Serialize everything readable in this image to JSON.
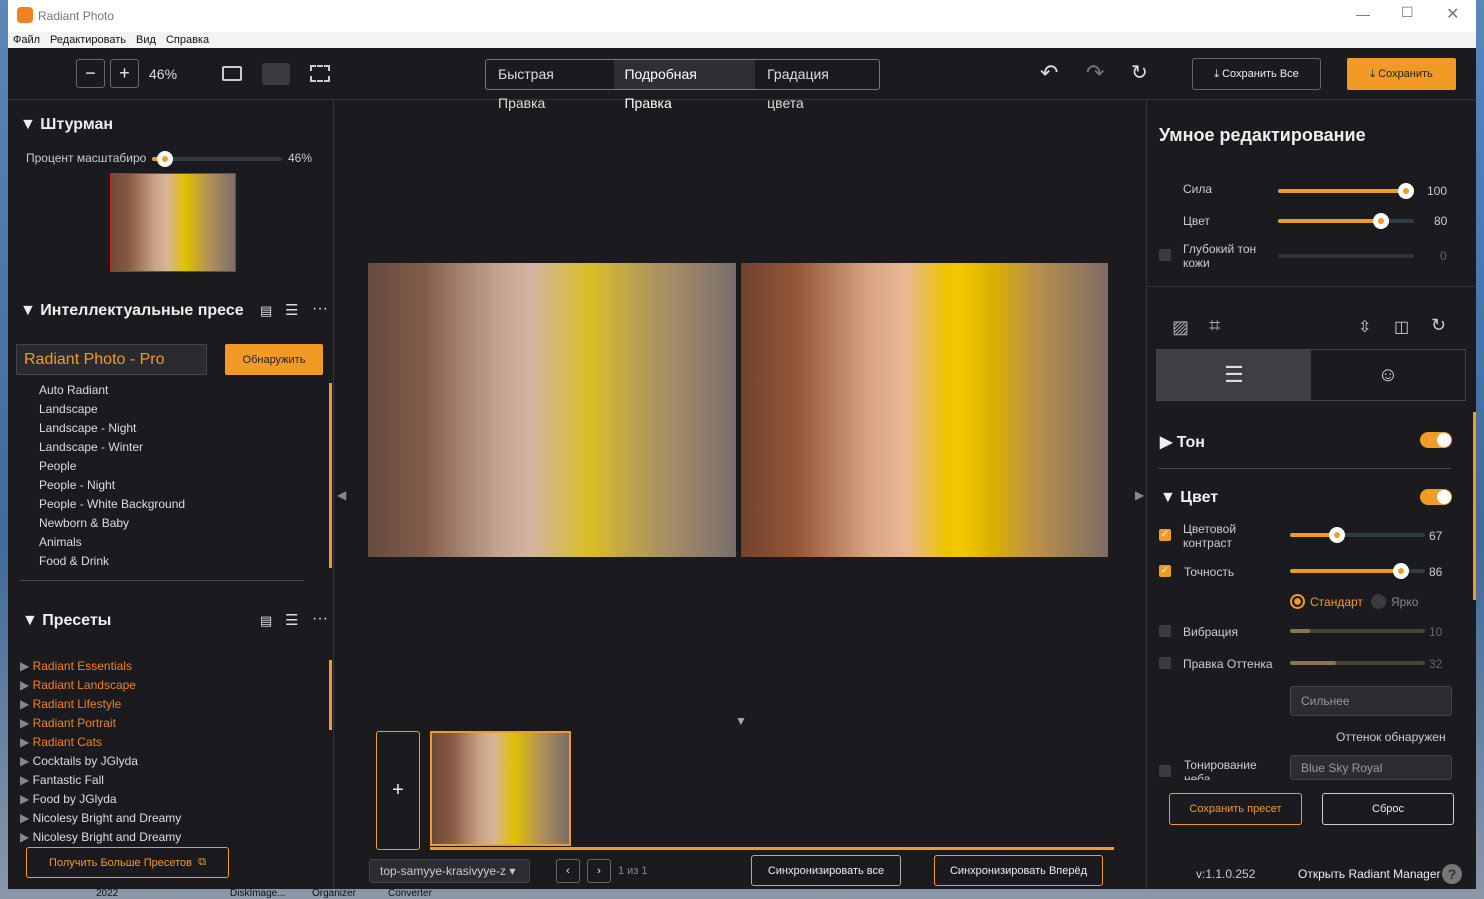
{
  "window": {
    "title": "Radiant Photo",
    "menu": [
      "Файл",
      "Редактировать",
      "Вид",
      "Справка"
    ]
  },
  "toolbar": {
    "zoom": "46%",
    "tabs": [
      "Быстрая Правка",
      "Подробная Правка",
      "Градация цвета"
    ],
    "active_tab": 1,
    "save_all": "Сохранить Все",
    "save": "Сохранить"
  },
  "navigator": {
    "title": "Штурман",
    "zoom_label": "Процент масштабиро",
    "zoom_value": "46%",
    "zoom_fraction": 0.1
  },
  "smart_presets": {
    "title": "Интеллектуальные пресе",
    "selected": "Radiant Photo - Pro",
    "detect": "Обнаружить",
    "items": [
      "Auto Radiant",
      "Landscape",
      "Landscape - Night",
      "Landscape - Winter",
      "People",
      "People - Night",
      "People - White Background",
      "Newborn & Baby",
      "Animals",
      "Food & Drink"
    ]
  },
  "presets": {
    "title": "Пресеты",
    "items": [
      {
        "label": "Radiant Essentials",
        "accent": true
      },
      {
        "label": "Radiant Landscape",
        "accent": true
      },
      {
        "label": "Radiant Lifestyle",
        "accent": true
      },
      {
        "label": "Radiant Portrait",
        "accent": true
      },
      {
        "label": "Radiant Cats",
        "accent": true
      },
      {
        "label": "Cocktails by JGlyda",
        "accent": false
      },
      {
        "label": "Fantastic Fall",
        "accent": false
      },
      {
        "label": "Food by JGlyda",
        "accent": false
      },
      {
        "label": "Nicolesy Bright and Dreamy",
        "accent": false
      },
      {
        "label": "Nicolesy Bright and Dreamy",
        "accent": false
      }
    ],
    "more": "Получить Больше Пресетов"
  },
  "filmstrip": {
    "file": "top-samyye-krasivyye-z",
    "page": "1 из 1",
    "sync_all": "Синхронизировать все",
    "sync_forward": "Синхронизировать Вперёд"
  },
  "smart": {
    "title": "Умное редактирование",
    "sliders": [
      {
        "label": "Сила",
        "value": "100"
      },
      {
        "label": "Цвет",
        "value": "80"
      },
      {
        "label": "Глубокий тон кожи",
        "value": "0"
      }
    ]
  },
  "tone": {
    "title": "Тон"
  },
  "color": {
    "title": "Цвет",
    "contrast": {
      "label": "Цветовой контраст",
      "value": "67"
    },
    "precision": {
      "label": "Точность",
      "value": "86"
    },
    "radio": [
      "Стандарт",
      "Ярко"
    ],
    "vibrance": {
      "label": "Вибрация",
      "value": "10"
    },
    "hue": {
      "label": "Правка Оттенка",
      "value": "32"
    },
    "hue_select": "Сильнее",
    "hue_detected": "Оттенок обнаружен",
    "sky": {
      "label": "Тонирование неба",
      "select": "Blue Sky Royal"
    }
  },
  "footer": {
    "save_preset": "Сохранить пресет",
    "reset": "Сброс",
    "version": "v:1.1.0.252",
    "manager": "Открыть Radiant Manager"
  },
  "taskbar": [
    "2022",
    "DiskImage...",
    "Organizer",
    "Converter"
  ],
  "colors": {
    "accent": "#f29a26",
    "bg": "#1b1b1f"
  }
}
